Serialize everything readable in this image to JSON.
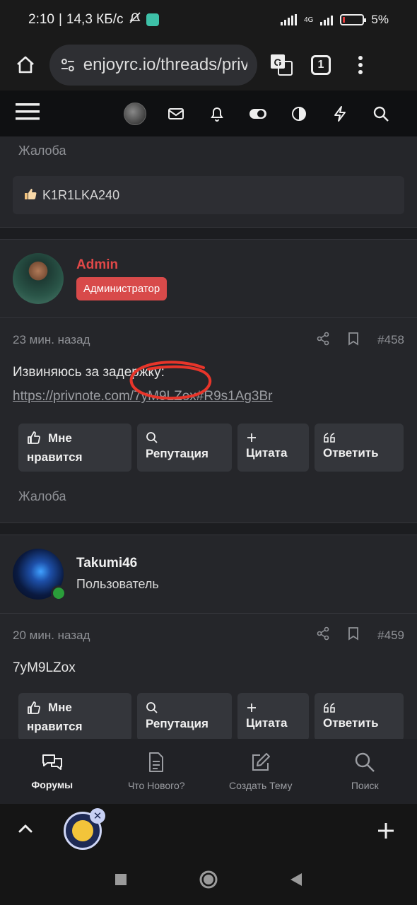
{
  "status_bar": {
    "time": "2:10",
    "net_speed": "14,3 КБ/с",
    "network": "4G",
    "battery": "5%"
  },
  "browser": {
    "url": "enjoyrc.io/threads/priv",
    "tab_count": "1"
  },
  "posts": [
    {
      "report_label": "Жалоба",
      "reactions_text": "K1R1LKA240"
    },
    {
      "username": "Admin",
      "role": "Администратор",
      "time": "23 мин. назад",
      "post_number": "#458",
      "text": "Извиняюсь за задержку:",
      "link": "https://privnote.com/7yM9LZox#R9s1Ag3Br",
      "buttons": {
        "like_line1": "Мне",
        "like_line2": "нравится",
        "reputation": "Репутация",
        "quote": "Цитата",
        "reply": "Ответить"
      },
      "report_label": "Жалоба"
    },
    {
      "username": "Takumi46",
      "role": "Пользователь",
      "time": "20 мин. назад",
      "post_number": "#459",
      "text": "7yM9LZox",
      "buttons": {
        "like_line1": "Мне",
        "like_line2": "нравится",
        "reputation": "Репутация",
        "quote": "Цитата",
        "reply": "Ответить"
      }
    }
  ],
  "bottom_nav": [
    {
      "label": "Форумы",
      "icon": "chat-bubbles-icon",
      "active": true
    },
    {
      "label": "Что Нового?",
      "icon": "document-icon"
    },
    {
      "label": "Создать Тему",
      "icon": "edit-icon"
    },
    {
      "label": "Поиск",
      "icon": "search-icon"
    }
  ],
  "colors": {
    "accent_red": "#e04848",
    "badge_red": "#d84a4a",
    "annotation_red": "#e8352a",
    "online_green": "#2a9d3a"
  }
}
